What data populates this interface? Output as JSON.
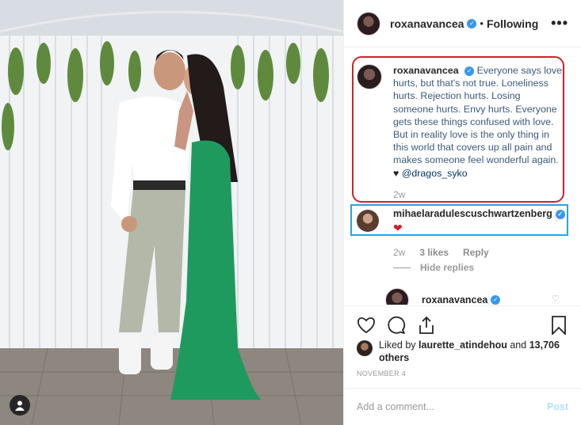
{
  "header": {
    "username": "roxanavancea",
    "separator": "•",
    "follow_status": "Following",
    "more": "•••"
  },
  "caption": {
    "username": "roxanavancea",
    "text": "Everyone says love hurts, but that's not true. Loneliness hurts. Rejection hurts. Losing someone hurts. Envy hurts. Everyone gets these things confused with love. But in reality love is the only thing in this world that covers up all pain and makes someone feel wonderful again.",
    "heart": "♥",
    "mention": "@dragos_syko",
    "time": "2w"
  },
  "comment": {
    "username": "mihaelaradulescuschwartzenberg",
    "text": "❤",
    "time": "2w",
    "likes": "3 likes",
    "reply": "Reply",
    "hide_replies": "Hide replies"
  },
  "reply": {
    "username": "roxanavancea"
  },
  "likes": {
    "prefix": "Liked by",
    "user": "laurette_atindehou",
    "and": "and",
    "count": "13,706 others"
  },
  "date": "NOVEMBER 4",
  "add_comment": {
    "placeholder": "Add a comment...",
    "post": "Post"
  },
  "colors": {
    "caption_highlight": "#d0202a",
    "comment_highlight": "#2ba3dc",
    "verified": "#3897f0"
  }
}
